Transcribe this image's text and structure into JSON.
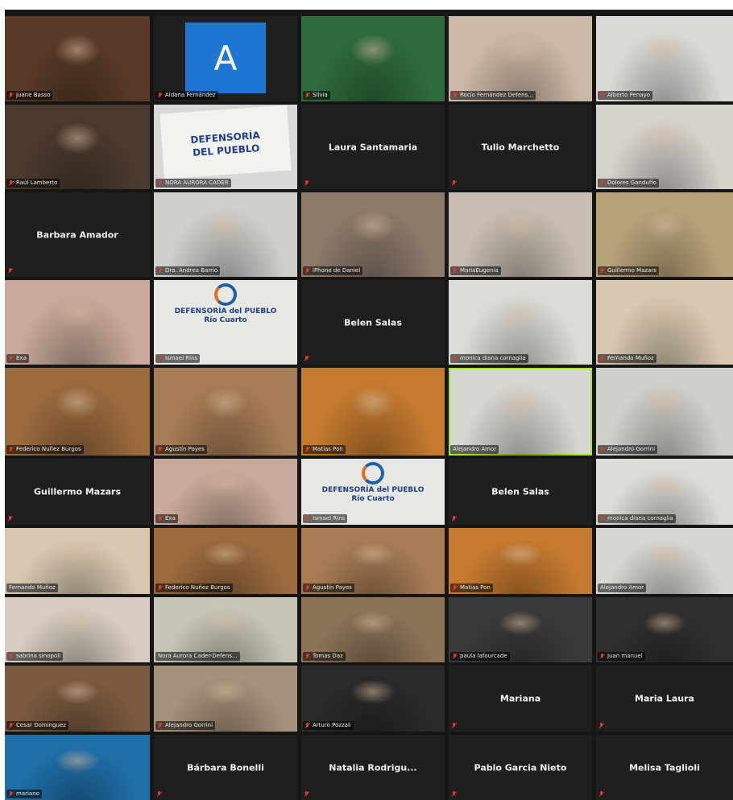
{
  "tiles": [
    {
      "name": "Juane Basso",
      "kind": "video",
      "bg": "#5a3b28",
      "label": true
    },
    {
      "name": "Aldana Fernández",
      "kind": "letter",
      "letter": "A",
      "bg": "#1f1f1f",
      "label": true
    },
    {
      "name": "Silvia",
      "kind": "video",
      "bg": "#2f6b3c",
      "label": true
    },
    {
      "name": "Rocío Fernández Defens...",
      "kind": "video",
      "bg": "#cbb8a6",
      "label": true
    },
    {
      "name": "Alberto Penayo",
      "kind": "video",
      "bg": "#d9dad6",
      "label": true
    },
    {
      "name": "Raúl Lamberto",
      "kind": "video",
      "bg": "#4b3a2e",
      "label": true
    },
    {
      "name": "NORA AURORA CADER",
      "kind": "flag",
      "bg": "#d8d8d8",
      "flag_line1": "DEFENSORÍA",
      "flag_line2": "DEL PUEBLO",
      "label": true
    },
    {
      "name": "Laura Santamaria",
      "kind": "name",
      "bg": "#1f1f1f"
    },
    {
      "name": "Tulio Marchetto",
      "kind": "name",
      "bg": "#1f1f1f"
    },
    {
      "name": "Dolores Ganduffo",
      "kind": "video",
      "bg": "#d6d2cc",
      "label": true
    },
    {
      "name": "Barbara Amador",
      "kind": "name",
      "bg": "#1f1f1f"
    },
    {
      "name": "Dra. Andrea Barrio",
      "kind": "video",
      "bg": "#cfd0cc",
      "label": true
    },
    {
      "name": "iPhone de Daniel",
      "kind": "video",
      "bg": "#8c7a6b",
      "label": true
    },
    {
      "name": "MariaEugenia",
      "kind": "video",
      "bg": "#c7bdb2",
      "label": true
    },
    {
      "name": "Guillermo Mazars",
      "kind": "video",
      "bg": "#b8a27a",
      "label": true
    },
    {
      "name": "Exa",
      "kind": "video",
      "bg": "#c9a99a",
      "label": true
    },
    {
      "name": "Ismael Rins",
      "kind": "banner",
      "bg": "#e7e7e4",
      "banner_line1": "DEFENSORÍA del PUEBLO",
      "banner_line2": "Río Cuarto",
      "label": true
    },
    {
      "name": "Belen Salas",
      "kind": "name",
      "bg": "#1f1f1f"
    },
    {
      "name": "monica diana cornaglia",
      "kind": "video",
      "bg": "#dcdcd6",
      "label": true
    },
    {
      "name": "Fernando Muñoz",
      "kind": "video",
      "bg": "#d8c8b0",
      "label": true
    },
    {
      "name": "Federico Nuñez Burgos",
      "kind": "video",
      "bg": "#9b6a3e",
      "label": true
    },
    {
      "name": "Agustín Payes",
      "kind": "video",
      "bg": "#a77c55",
      "label": true
    },
    {
      "name": "Matias Pon",
      "kind": "video",
      "bg": "#c57a2f",
      "label": true
    },
    {
      "name": "Alejandro Amor",
      "kind": "video",
      "bg": "#d7d7d1",
      "label": true,
      "active": true,
      "nomic": true
    },
    {
      "name": "Alejandro Gorrini",
      "kind": "video",
      "bg": "#cfcfcb",
      "label": true
    },
    {
      "name": "Guillermo Mazars",
      "kind": "name",
      "bg": "#1f1f1f"
    },
    {
      "name": "Exa",
      "kind": "video",
      "bg": "#c9a99a",
      "label": true
    },
    {
      "name": "Ismael Rins",
      "kind": "banner",
      "bg": "#e7e7e4",
      "banner_line1": "DEFENSORÍA del PUEBLO",
      "banner_line2": "Río Cuarto",
      "label": true
    },
    {
      "name": "Belen Salas",
      "kind": "name",
      "bg": "#1f1f1f"
    },
    {
      "name": "monica diana cornaglia",
      "kind": "video",
      "bg": "#dcdcd6",
      "label": true
    },
    {
      "name": "Fernando Muñoz",
      "kind": "video",
      "bg": "#d8c8b0",
      "label": true,
      "nomic": true
    },
    {
      "name": "Federico Nuñez Burgos",
      "kind": "video",
      "bg": "#9b6a3e",
      "label": true
    },
    {
      "name": "Agustín Payes",
      "kind": "video",
      "bg": "#a77c55",
      "label": true
    },
    {
      "name": "Matias Pon",
      "kind": "video",
      "bg": "#c57a2f",
      "label": true
    },
    {
      "name": "Alejandro Amor",
      "kind": "video",
      "bg": "#d7d7d1",
      "label": true,
      "nomic": true
    },
    {
      "name": "sabrina sinopoli",
      "kind": "video",
      "bg": "#d6ccc0",
      "label": true
    },
    {
      "name": "Nora Aurora Cader-Defens...",
      "kind": "video",
      "bg": "#c7c3b7",
      "label": true,
      "nomic": true
    },
    {
      "name": "Tomas Daz",
      "kind": "video",
      "bg": "#8c7358",
      "label": true
    },
    {
      "name": "paula lafourcade",
      "kind": "video",
      "bg": "#3a3a3a",
      "label": true
    },
    {
      "name": "Juan manuel",
      "kind": "video",
      "bg": "#2f2f2f",
      "label": true
    },
    {
      "name": "Cesar Dominguez",
      "kind": "video",
      "bg": "#7a5a40",
      "label": true
    },
    {
      "name": "Alejandro Gorrini",
      "kind": "video",
      "bg": "#a7917a",
      "label": true
    },
    {
      "name": "Arturo Pozzali",
      "kind": "video",
      "bg": "#2a2a2a",
      "label": true
    },
    {
      "name": "Mariana",
      "kind": "name",
      "bg": "#1f1f1f"
    },
    {
      "name": "Maria Laura",
      "kind": "name",
      "bg": "#1f1f1f"
    },
    {
      "name": "mariano",
      "kind": "video",
      "bg": "#1f6fa8",
      "label": true
    },
    {
      "name": "Bárbara Bonelli",
      "kind": "name",
      "bg": "#1f1f1f"
    },
    {
      "name": "Natalia  Rodrigu...",
      "kind": "name",
      "bg": "#1f1f1f"
    },
    {
      "name": "Pablo Garcia Nieto",
      "kind": "name",
      "bg": "#1f1f1f"
    },
    {
      "name": "Melisa Taglioli",
      "kind": "name",
      "bg": "#1f1f1f"
    }
  ]
}
